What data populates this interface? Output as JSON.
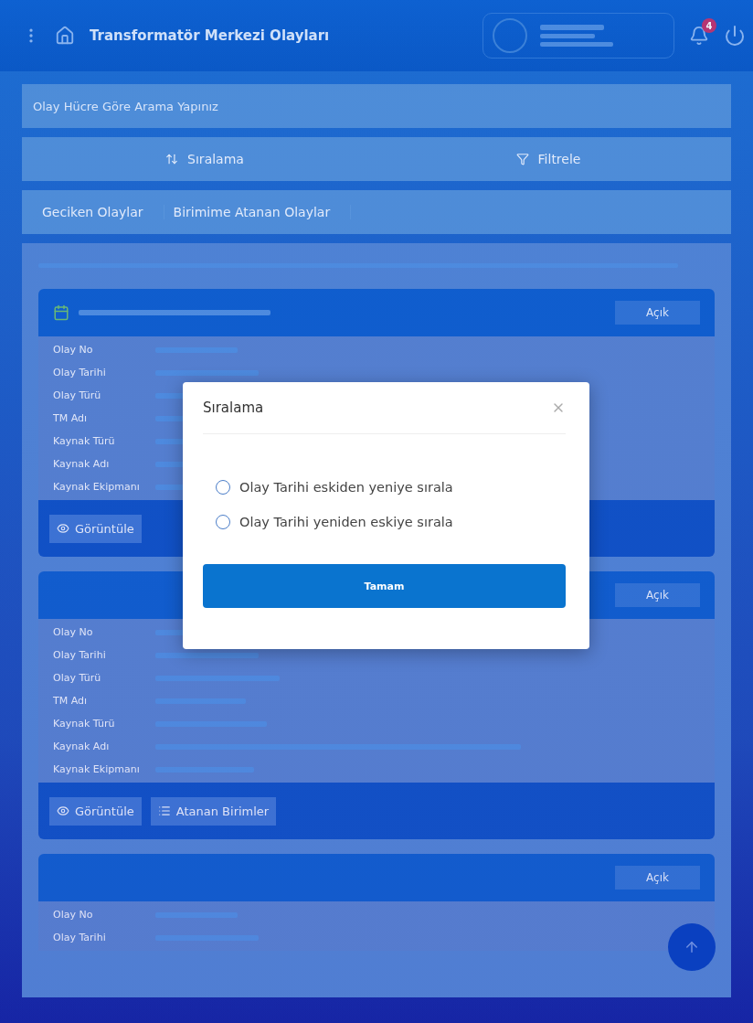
{
  "header": {
    "title": "Transformatör Merkezi Olayları",
    "notification_count": "4"
  },
  "search": {
    "placeholder": "Olay Hücre Göre Arama Yapınız"
  },
  "toolbar": [
    "Sıralama",
    "Filtrele"
  ],
  "tabs": [
    {
      "label": "Geciken Olaylar",
      "selected": false
    },
    {
      "label": "Birimime Atanan Olaylar",
      "selected": false
    }
  ],
  "cards": [
    {
      "status": "Açık",
      "has_notice": true,
      "fields": [
        "Olay No",
        "Olay Tarihi",
        "Olay Türü",
        "TM Adı",
        "Kaynak Türü",
        "Kaynak Adı",
        "Kaynak Ekipmanı"
      ],
      "actions": [
        "Görüntüle"
      ]
    },
    {
      "status": "Açık",
      "has_notice": false,
      "fields": [
        "Olay No",
        "Olay Tarihi",
        "Olay Türü",
        "TM Adı",
        "Kaynak Türü",
        "Kaynak Adı",
        "Kaynak Ekipmanı"
      ],
      "actions": [
        "Görüntüle",
        "Atanan Birimler"
      ]
    },
    {
      "status": "Açık",
      "has_notice": false,
      "fields": [
        "Olay No",
        "Olay Tarihi"
      ]
    }
  ],
  "dialog": {
    "title": "Sıralama",
    "options": [
      {
        "label": "Olay Tarihi eskiden yeniye sırala",
        "selected": false
      },
      {
        "label": "Olay Tarihi yeniden eskiye sırala",
        "selected": false
      }
    ],
    "confirm": "Tamam"
  }
}
